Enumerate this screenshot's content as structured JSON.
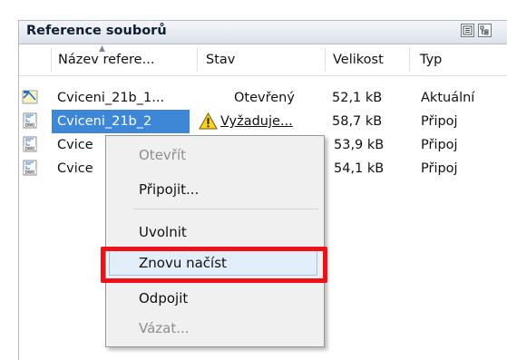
{
  "panel": {
    "title": "Reference souborů",
    "list_view_icon": "list-view-icon",
    "tree_view_icon": "tree-view-icon"
  },
  "columns": [
    "Název refere...",
    "Stav",
    "Velikost",
    "Typ"
  ],
  "rows": [
    {
      "name": "Cviceni_21b_1...",
      "status": "Otevřený",
      "size": "52,1 kB",
      "type": "Aktuální",
      "icon": "drawing-current-icon"
    },
    {
      "name": "Cviceni_21b_2",
      "status": "Vyžaduje...",
      "size": "58,7 kB",
      "type": "Připoj",
      "icon": "dwg-file-icon",
      "status_icon": "warning-icon",
      "selected": true
    },
    {
      "name": "Cvice",
      "status": "",
      "size": "53,9 kB",
      "type": "Připoj",
      "icon": "dwg-file-icon"
    },
    {
      "name": "Cvice",
      "status": "",
      "size": "54,1 kB",
      "type": "Připoj",
      "icon": "dwg-file-icon"
    }
  ],
  "context_menu": {
    "items": [
      {
        "label": "Otevřít",
        "disabled": true
      },
      {
        "label": "Připojit...",
        "disabled": false
      },
      {
        "label": "Uvolnit",
        "disabled": false
      },
      {
        "label": "Znovu načíst",
        "disabled": false,
        "highlighted": true
      },
      {
        "label": "Odpojit",
        "disabled": false
      },
      {
        "label": "Vázat...",
        "disabled": true
      }
    ]
  },
  "colors": {
    "selection": "#3d87d6",
    "highlight_box": "#ee1119",
    "menu_bg": "#f0f0f0"
  }
}
